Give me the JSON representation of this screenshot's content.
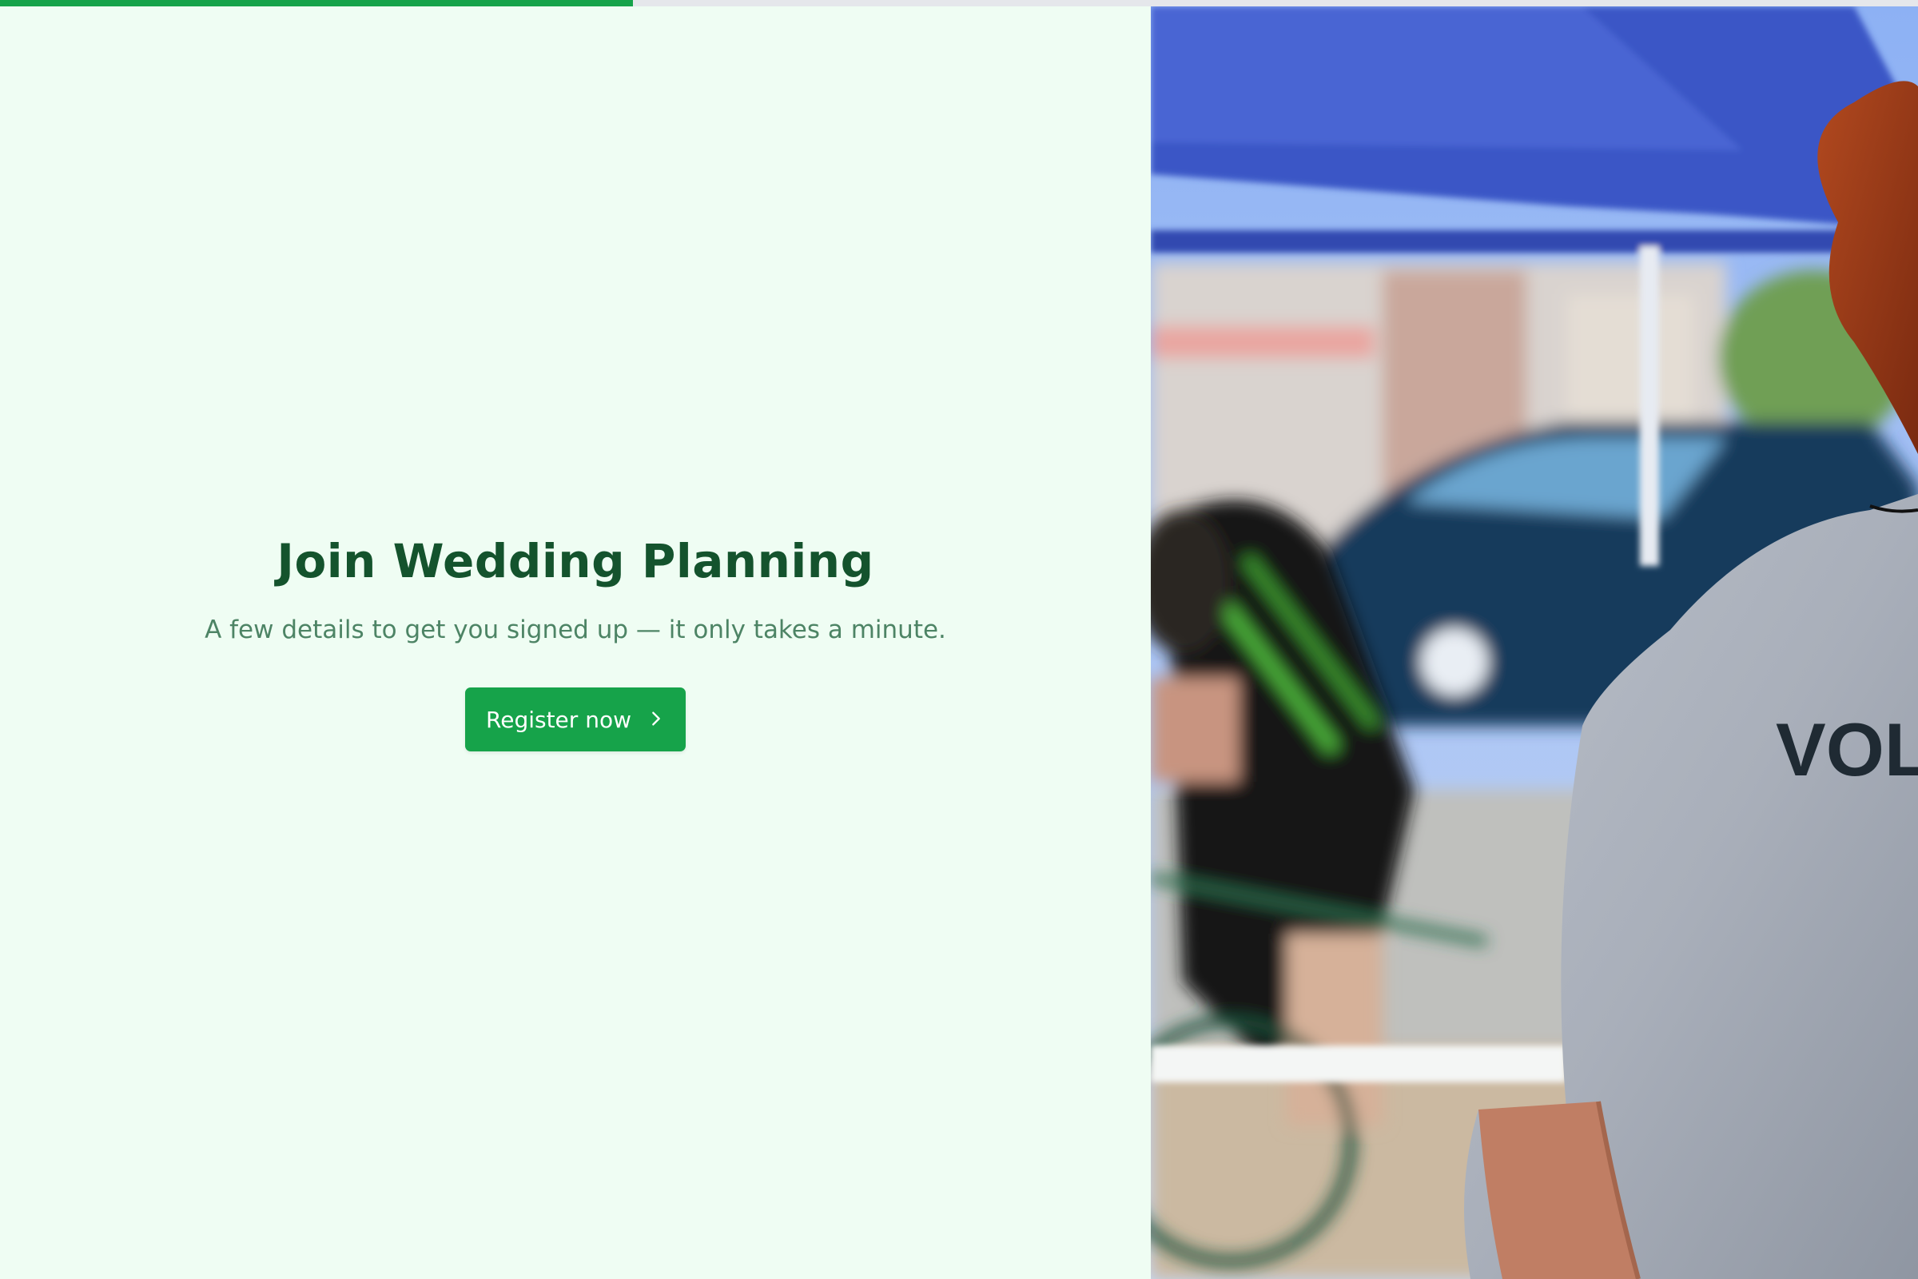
{
  "progress": {
    "value": 0.33,
    "color": "#16a34a",
    "track_color": "#e5e7eb"
  },
  "hero": {
    "title": "Join Wedding Planning",
    "subtitle": "A few details to get you signed up — it only takes a minute.",
    "cta_label": "Register now",
    "cta_icon": "chevron-right-icon"
  },
  "photo": {
    "shirt_text": "VOL"
  },
  "colors": {
    "background": "#effdf3",
    "title": "#14532d",
    "subtitle": "#4d8465",
    "button": "#16a34a"
  }
}
